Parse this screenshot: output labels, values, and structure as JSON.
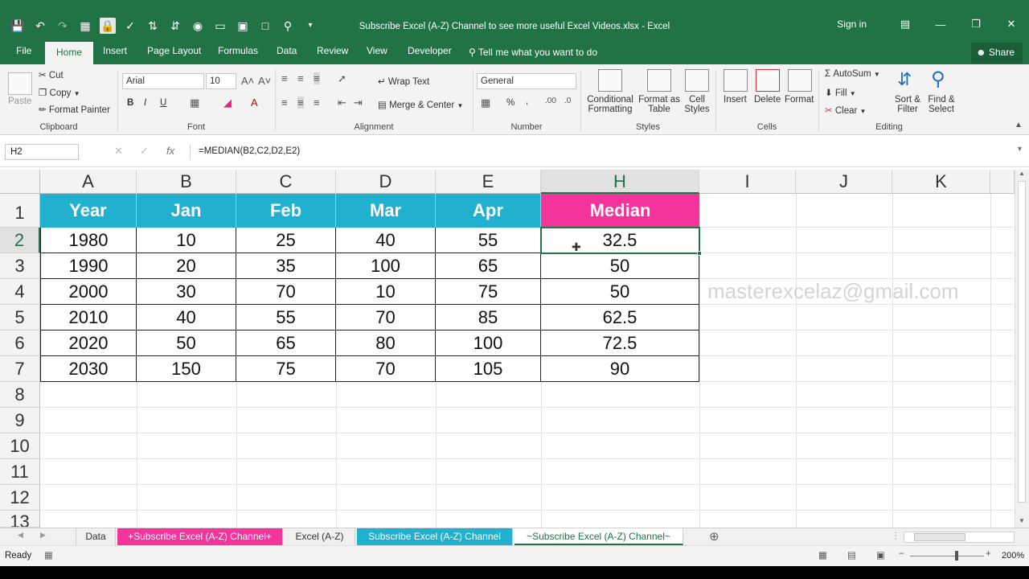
{
  "window": {
    "title": "Subscribe Excel (A-Z) Channel to see more useful Excel Videos.xlsx - Excel",
    "sign_in": "Sign in"
  },
  "qat_icons": [
    "save-icon",
    "undo-icon",
    "redo-icon",
    "form-icon",
    "lock-icon",
    "spell-icon",
    "sort-asc-icon",
    "sort-desc-icon",
    "camera-icon",
    "shapes-icon",
    "picture-icon",
    "new-doc-icon",
    "print-preview-icon",
    "customize-qat-icon"
  ],
  "tabs": [
    {
      "label": "File"
    },
    {
      "label": "Home"
    },
    {
      "label": "Insert"
    },
    {
      "label": "Page Layout"
    },
    {
      "label": "Formulas"
    },
    {
      "label": "Data"
    },
    {
      "label": "Review"
    },
    {
      "label": "View"
    },
    {
      "label": "Developer"
    }
  ],
  "tell_me": "Tell me what you want to do",
  "share": "Share",
  "ribbon": {
    "clipboard": {
      "paste": "Paste",
      "cut": "Cut",
      "copy": "Copy",
      "format_painter": "Format Painter",
      "label": "Clipboard"
    },
    "font": {
      "name": "Arial",
      "size": "10",
      "bold": "B",
      "italic": "I",
      "underline": "U",
      "label": "Font"
    },
    "alignment": {
      "wrap_text": "Wrap Text",
      "merge_center": "Merge & Center",
      "label": "Alignment"
    },
    "number": {
      "format": "General",
      "percent": "%",
      "comma": ",",
      "label": "Number"
    },
    "styles": {
      "conditional_1": "Conditional",
      "conditional_2": "Formatting",
      "format_table_1": "Format as",
      "format_table_2": "Table",
      "cell_styles_1": "Cell",
      "cell_styles_2": "Styles",
      "label": "Styles"
    },
    "cells": {
      "insert": "Insert",
      "delete": "Delete",
      "format": "Format",
      "label": "Cells"
    },
    "editing": {
      "autosum": "AutoSum",
      "fill": "Fill",
      "clear": "Clear",
      "sort_filter_1": "Sort &",
      "sort_filter_2": "Filter",
      "find_select_1": "Find &",
      "find_select_2": "Select",
      "label": "Editing"
    }
  },
  "formula_bar": {
    "name_box": "H2",
    "formula": "=MEDIAN(B2,C2,D2,E2)"
  },
  "grid": {
    "columns": [
      "A",
      "B",
      "C",
      "D",
      "E",
      "H",
      "I",
      "J",
      "K"
    ],
    "rows": [
      "1",
      "2",
      "3",
      "4",
      "5",
      "6",
      "7",
      "8",
      "9",
      "10",
      "11",
      "12",
      "13"
    ],
    "header": [
      "Year",
      "Jan",
      "Feb",
      "Mar",
      "Apr",
      "Median"
    ],
    "data": [
      [
        "1980",
        "10",
        "25",
        "40",
        "55",
        "32.5"
      ],
      [
        "1990",
        "20",
        "35",
        "100",
        "65",
        "50"
      ],
      [
        "2000",
        "30",
        "70",
        "10",
        "75",
        "50"
      ],
      [
        "2010",
        "40",
        "55",
        "70",
        "85",
        "62.5"
      ],
      [
        "2020",
        "50",
        "65",
        "80",
        "100",
        "72.5"
      ],
      [
        "2030",
        "150",
        "75",
        "70",
        "105",
        "90"
      ]
    ],
    "watermark": "masterexcelaz@gmail.com",
    "colors": {
      "header_bg": "#22b0cf",
      "median_bg": "#f2349b",
      "accent": "#217346"
    }
  },
  "sheets": [
    {
      "label": "Data"
    },
    {
      "label": "+Subscribe Excel (A-Z) Channel+"
    },
    {
      "label": "Excel (A-Z)"
    },
    {
      "label": "Subscribe Excel (A-Z) Channel"
    },
    {
      "label": "~Subscribe Excel (A-Z) Channel~"
    }
  ],
  "status": {
    "ready": "Ready",
    "zoom": "200%"
  }
}
